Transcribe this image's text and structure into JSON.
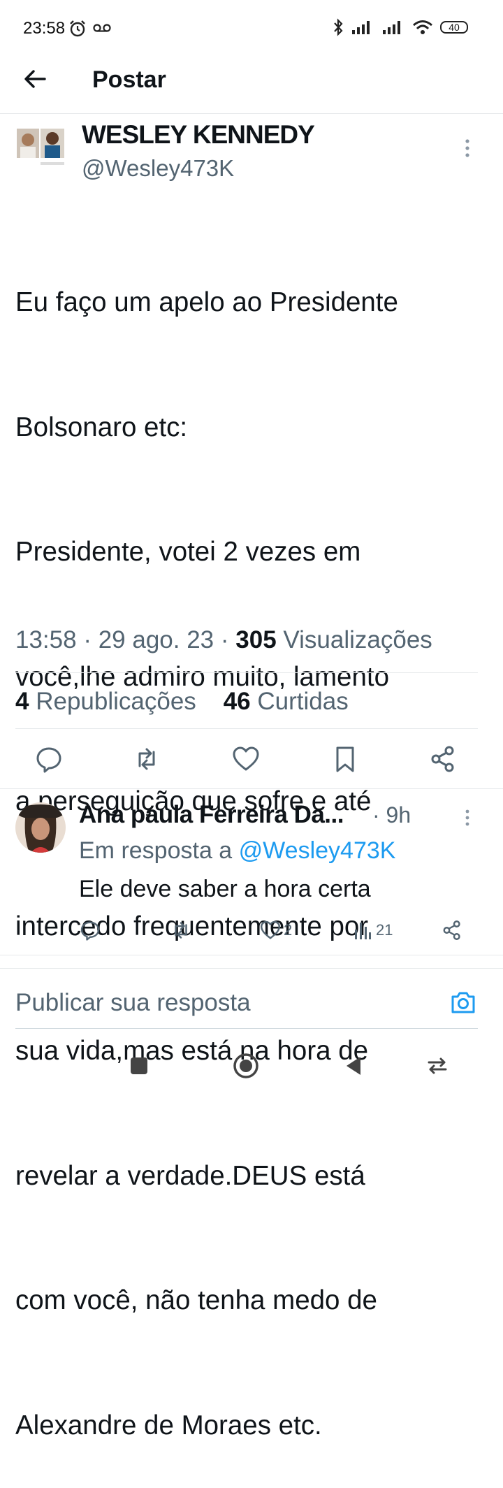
{
  "status_bar": {
    "time": "23:58",
    "battery": "40"
  },
  "header": {
    "title": "Postar"
  },
  "tweet": {
    "author_name": "WESLEY KENNEDY",
    "handle": "@Wesley473K",
    "text_lines": [
      "Eu faço um apelo ao Presidente",
      "Bolsonaro etc:",
      "Presidente, votei 2 vezes em",
      "você,lhe admiro muito, lamento",
      "a perseguição que sofre e até",
      "intercedo frequentemente por",
      "sua vida,mas está na hora de",
      "revelar a verdade.DEUS está",
      "com você, não tenha medo de",
      "Alexandre de Moraes etc."
    ],
    "time": "13:58",
    "date": "29 ago. 23",
    "views_count": "305",
    "views_label": "Visualizações",
    "reposts_count": "4",
    "reposts_label": "Republicações",
    "likes_count": "46",
    "likes_label": "Curtidas"
  },
  "reply": {
    "author_name": "Ana paula Ferreira Da...",
    "time": "· 9h",
    "context_prefix": "Em resposta a",
    "context_mention": "@Wesley473K",
    "text": "Ele deve saber a hora certa",
    "likes": "2",
    "views": "21"
  },
  "composer": {
    "placeholder": "Publicar sua resposta"
  },
  "colors": {
    "accent": "#1d9bf0",
    "secondary_text": "#536471",
    "primary_text": "#0f1419"
  }
}
